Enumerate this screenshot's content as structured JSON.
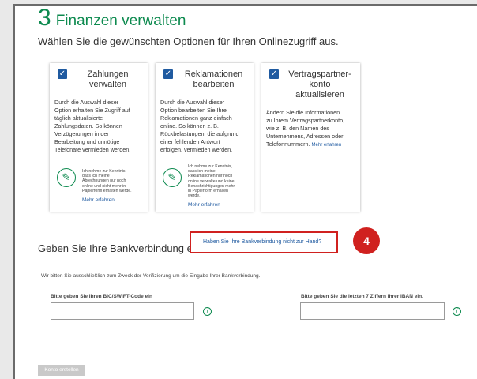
{
  "header": {
    "step_number": "3",
    "title": "Finanzen verwalten",
    "subtitle": "Wählen Sie die gewünschten Optionen für Ihren Onlinezugriff aus."
  },
  "options": [
    {
      "title_lines": [
        "Zahlungen",
        "verwalten"
      ],
      "checked": true,
      "description": [
        "Durch die Auswahl dieser",
        "Option erhalten Sie Zugriff auf",
        "täglich aktualisierte",
        "Zahlungsdaten. So können",
        "Verzögerungen in der",
        "Bearbeitung und unnötige",
        "Telefonate vermieden werden."
      ],
      "paperless_text": [
        "Ich nehme zur Kenntnis,",
        "dass ich meine",
        "Abrechnungen nur noch",
        "online und nicht mehr in",
        "Papierform erhalten werde."
      ],
      "more_link": "Mehr erfahren"
    },
    {
      "title_lines": [
        "Reklamationen",
        "bearbeiten"
      ],
      "checked": true,
      "description": [
        "Durch die Auswahl dieser",
        "Option bearbeiten Sie Ihre",
        "Reklamationen ganz einfach",
        "online. So können z. B.",
        "Rückbelastungen, die aufgrund",
        "einer fehlenden Antwort",
        "erfolgen, vermieden werden."
      ],
      "paperless_text": [
        "Ich nehme zur Kenntnis,",
        "dass ich meine",
        "Reklamationen nur noch",
        "online verwalte und keine",
        "Benachrichtigungen mehr",
        "in Papierform erhalten",
        "werde."
      ],
      "more_link": "Mehr erfahren"
    },
    {
      "title_lines": [
        "Vertragspartner-",
        "konto",
        "aktualisieren"
      ],
      "checked": true,
      "description": [
        "Ändern Sie die Informationen",
        "zu Ihrem Vertragspartnerkonto,",
        "wie z. B. den Namen des",
        "Unternehmens, Adressen oder",
        "Telefonnummern."
      ],
      "more_link": "Mehr erfahren"
    }
  ],
  "bank": {
    "title": "Geben Sie Ihre Bankverbindung ein.",
    "help_link": "Haben Sie Ihre Bankverbindung nicht zur Hand?",
    "callout_number": "4",
    "verify_text": "Wir bitten Sie ausschließlich zum Zweck der Verifizierung um die Eingabe Ihrer Bankverbindung.",
    "bic_label": "Bitte geben Sie Ihren BIC/SWIFT-Code ein",
    "iban_label": "Bitte geben Sie die letzten 7 Ziffern Ihrer IBAN ein.",
    "info_icon": "i"
  },
  "actions": {
    "create_account": "Konto erstellen"
  },
  "colors": {
    "brand_green": "#0d8a4f",
    "link_blue": "#1f5aa0",
    "callout_red": "#d0211f",
    "checkbox_blue": "#1f5aa0"
  }
}
